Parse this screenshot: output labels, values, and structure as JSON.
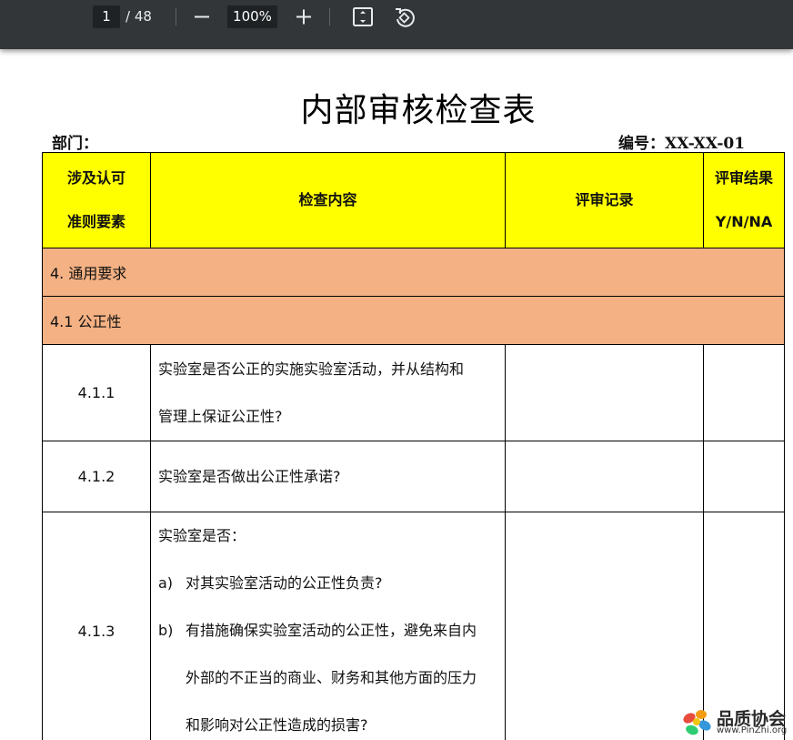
{
  "viewer": {
    "page_current": "1",
    "page_total": "/ 48",
    "zoom": "100%",
    "icons": [
      "minus-icon",
      "plus-icon",
      "fit-page-icon",
      "rotate-icon"
    ]
  },
  "document": {
    "title": "内部审核检查表",
    "dept_label": "部门：",
    "docno": "编号：XX-XX-01",
    "header": {
      "col1": [
        "涉及认可",
        "准则要素"
      ],
      "col2": "检查内容",
      "col3": "评审记录",
      "col4": [
        "评审结果",
        "Y/N/NA"
      ]
    },
    "sections": [
      {
        "label": "4. 通用要求"
      },
      {
        "label": "4.1  公正性"
      }
    ],
    "rows": [
      {
        "code": "4.1.1",
        "lines": [
          "实验室是否公正的实施实验室活动，并从结构和",
          "管理上保证公正性?"
        ]
      },
      {
        "code": "4.1.2",
        "lines": [
          "实验室是否做出公正性承诺?"
        ]
      },
      {
        "code": "4.1.3",
        "intro": "实验室是否：",
        "a_label": "a)",
        "a_text": "对其实验室活动的公正性负责?",
        "b_label": "b)",
        "b_text": "有措施确保实验室活动的公正性，避免来自内",
        "b_cont1": "外部的不正当的商业、财务和其他方面的压力",
        "b_cont2": "和影响对公正性造成的损害?"
      }
    ]
  },
  "watermark": {
    "name": "品质协会",
    "url": "www.PinZhi.org"
  },
  "colors": {
    "toolbar": "#323639",
    "header_fill": "#ffff00",
    "section_fill": "#f4b183"
  }
}
